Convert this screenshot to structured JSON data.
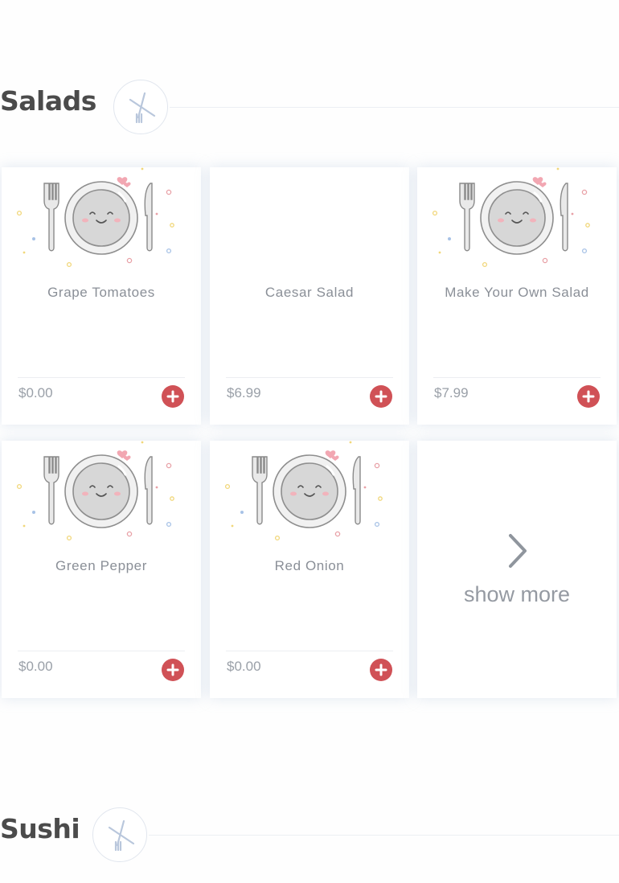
{
  "sections": [
    {
      "title": "Salads",
      "items": [
        {
          "name": "Grape Tomatoes",
          "price": "$0.00",
          "has_image": true
        },
        {
          "name": "Caesar Salad",
          "price": "$6.99",
          "has_image": false
        },
        {
          "name": "Make Your Own Salad",
          "price": "$7.99",
          "has_image": true
        },
        {
          "name": "Green Pepper",
          "price": "$0.00",
          "has_image": true
        },
        {
          "name": "Red Onion",
          "price": "$0.00",
          "has_image": true
        }
      ],
      "show_more_label": "show more"
    },
    {
      "title": "Sushi"
    }
  ],
  "icons": {
    "section_badge": "fork-knife-icon",
    "add": "plus-circle-icon",
    "show_more": "chevron-right-icon",
    "placeholder": "smiling-plate-icon"
  },
  "colors": {
    "add_button": "#d05156",
    "title": "#4b4b4b",
    "item_text": "#8a8f97",
    "badge_stroke": "#b9c7dc"
  }
}
